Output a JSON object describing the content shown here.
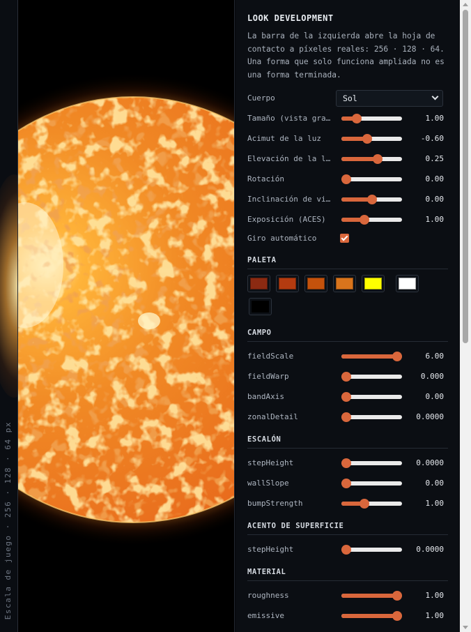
{
  "left_strip": {
    "label": "Escala de juego · 256 · 128 · 64 px"
  },
  "panel": {
    "title": "LOOK DEVELOPMENT",
    "intro": "La barra de la izquierda abre la hoja de contacto a píxeles reales: 256 · 128 · 64. Una forma que solo funciona ampliada no es una forma terminada.",
    "body": {
      "label": "Cuerpo",
      "selected": "Sol"
    },
    "controls": [
      {
        "label": "Tamaño (vista grande)",
        "value": "1.00",
        "fraction": 0.21
      },
      {
        "label": "Acimut de la luz",
        "value": "-0.60",
        "fraction": 0.41
      },
      {
        "label": "Elevación de la luz",
        "value": "0.25",
        "fraction": 0.62
      },
      {
        "label": "Rotación",
        "value": "0.00",
        "fraction": 0.0
      },
      {
        "label": "Inclinación de vista",
        "value": "0.00",
        "fraction": 0.5
      },
      {
        "label": "Exposición (ACES)",
        "value": "1.00",
        "fraction": 0.35
      }
    ],
    "auto_spin": {
      "label": "Giro automático",
      "checked": true
    },
    "palette": {
      "heading": "PALETA",
      "colors": [
        "#8b2a12",
        "#b33b10",
        "#c4520c",
        "#d8741c",
        "#ffff00",
        "#ffffff",
        "#000000"
      ]
    },
    "field": {
      "heading": "CAMPO",
      "controls": [
        {
          "label": "fieldScale",
          "value": "6.00",
          "fraction": 1.0
        },
        {
          "label": "fieldWarp",
          "value": "0.000",
          "fraction": 0.0
        },
        {
          "label": "bandAxis",
          "value": "0.00",
          "fraction": 0.0
        },
        {
          "label": "zonalDetail",
          "value": "0.0000",
          "fraction": 0.0
        }
      ]
    },
    "step": {
      "heading": "ESCALÓN",
      "controls": [
        {
          "label": "stepHeight",
          "value": "0.0000",
          "fraction": 0.0
        },
        {
          "label": "wallSlope",
          "value": "0.00",
          "fraction": 0.0
        },
        {
          "label": "bumpStrength",
          "value": "1.00",
          "fraction": 0.36
        }
      ]
    },
    "accent": {
      "heading": "ACENTO DE SUPERFICIE",
      "controls": [
        {
          "label": "stepHeight",
          "value": "0.0000",
          "fraction": 0.0
        }
      ]
    },
    "material": {
      "heading": "MATERIAL",
      "controls": [
        {
          "label": "roughness",
          "value": "1.00",
          "fraction": 1.0
        },
        {
          "label": "emissive",
          "value": "1.00",
          "fraction": 1.0
        }
      ]
    }
  }
}
